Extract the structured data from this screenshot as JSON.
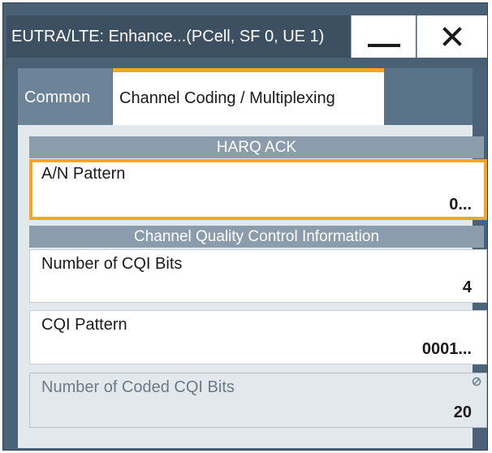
{
  "window": {
    "title": "EUTRA/LTE: Enhance...(PCell, SF 0, UE 1)",
    "minimize_icon": "minimize-icon",
    "close_icon": "close-icon",
    "close_glyph": "✕"
  },
  "tabs": [
    {
      "label": "Common",
      "active": false
    },
    {
      "label": "Channel Coding / Multiplexing",
      "active": true
    }
  ],
  "sections": {
    "harq": {
      "header": "HARQ ACK",
      "fields": [
        {
          "label": "A/N Pattern",
          "value": "0...",
          "focused": true
        }
      ]
    },
    "cqi": {
      "header": "Channel Quality Control Information",
      "fields": [
        {
          "label": "Number of CQI Bits",
          "value": "4"
        },
        {
          "label": "CQI Pattern",
          "value": "0001..."
        },
        {
          "label": "Number of Coded CQI Bits",
          "value": "20",
          "disabled": true,
          "icon": "not-editable-icon"
        }
      ]
    }
  },
  "colors": {
    "accent": "#f5a623",
    "titlebar": "#3c5062",
    "section_header": "#8b9dad"
  }
}
